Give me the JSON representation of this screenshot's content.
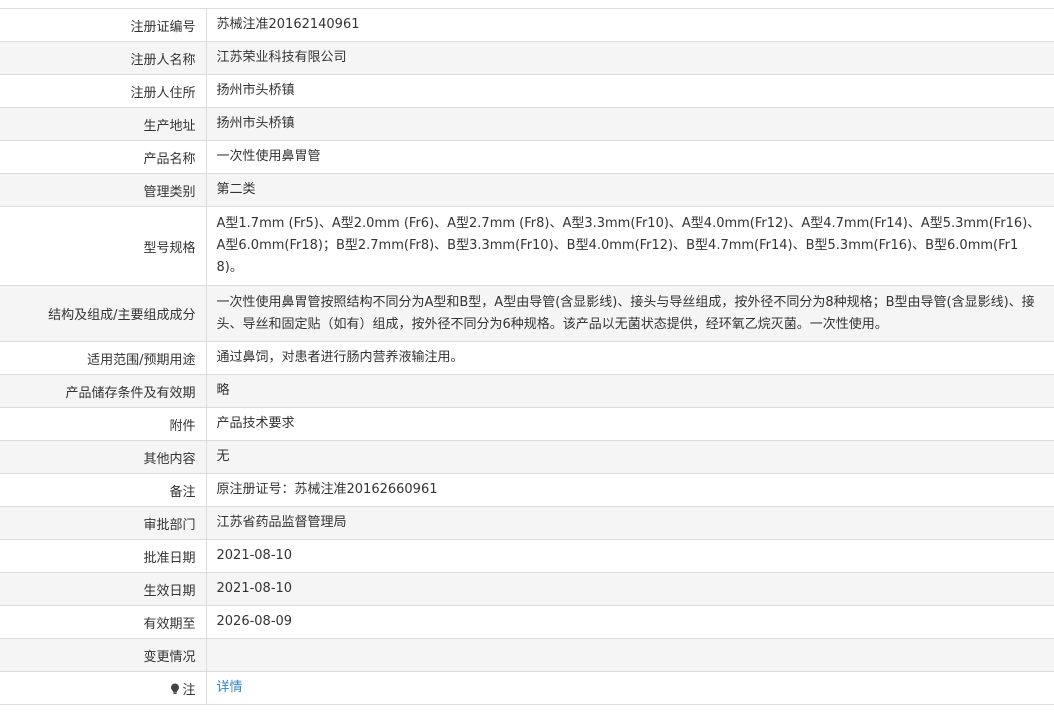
{
  "rows": [
    {
      "label": "注册证编号",
      "value": "苏械注准20162140961"
    },
    {
      "label": "注册人名称",
      "value": "江苏荣业科技有限公司"
    },
    {
      "label": "注册人住所",
      "value": "扬州市头桥镇"
    },
    {
      "label": "生产地址",
      "value": "扬州市头桥镇"
    },
    {
      "label": "产品名称",
      "value": "一次性使用鼻胃管"
    },
    {
      "label": "管理类别",
      "value": "第二类"
    },
    {
      "label": "型号规格",
      "value": "A型1.7mm (Fr5)、A型2.0mm (Fr6)、A型2.7mm (Fr8)、A型3.3mm(Fr10)、A型4.0mm(Fr12)、A型4.7mm(Fr14)、A型5.3mm(Fr16)、A型6.0mm(Fr18)；B型2.7mm(Fr8)、B型3.3mm(Fr10)、B型4.0mm(Fr12)、B型4.7mm(Fr14)、B型5.3mm(Fr16)、B型6.0mm(Fr18)。"
    },
    {
      "label": "结构及组成/主要组成成分",
      "value": "一次性使用鼻胃管按照结构不同分为A型和B型，A型由导管(含显影线)、接头与导丝组成，按外径不同分为8种规格；B型由导管(含显影线)、接头、导丝和固定贴（如有）组成，按外径不同分为6种规格。该产品以无菌状态提供，经环氧乙烷灭菌。一次性使用。"
    },
    {
      "label": "适用范围/预期用途",
      "value": "通过鼻饲，对患者进行肠内营养液输注用。"
    },
    {
      "label": "产品储存条件及有效期",
      "value": "略"
    },
    {
      "label": "附件",
      "value": "产品技术要求"
    },
    {
      "label": "其他内容",
      "value": "无"
    },
    {
      "label": "备注",
      "value": "原注册证号：苏械注准20162660961"
    },
    {
      "label": "审批部门",
      "value": "江苏省药品监督管理局"
    },
    {
      "label": "批准日期",
      "value": "2021-08-10"
    },
    {
      "label": "生效日期",
      "value": "2021-08-10"
    },
    {
      "label": "有效期至",
      "value": "2026-08-09"
    },
    {
      "label": "变更情况",
      "value": ""
    }
  ],
  "note": {
    "label": "注",
    "icon": "lightbulb-icon",
    "link": "详情"
  },
  "colors": {
    "border": "#dcdcdc",
    "alt_row": "#f5f5f5",
    "link": "#3385c6"
  }
}
